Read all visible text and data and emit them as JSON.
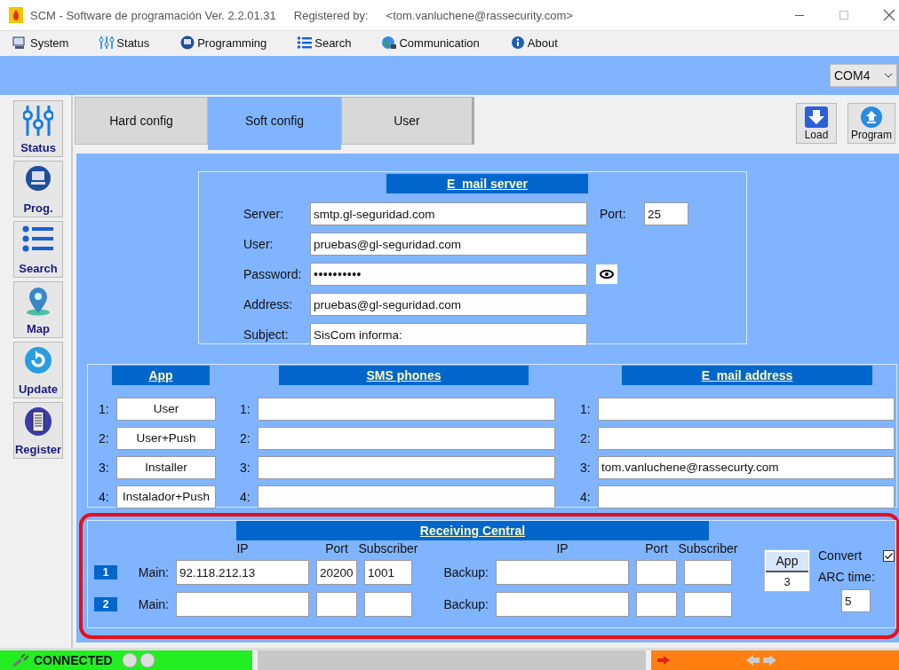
{
  "window": {
    "title": "SCM - Software de programación Ver. 2.2.01.31",
    "registered_label": "Registered by:",
    "registered_email": "<tom.vanluchene@rassecurity.com>"
  },
  "menu": [
    {
      "label": "System",
      "kind": "system"
    },
    {
      "label": "Status",
      "kind": "status"
    },
    {
      "label": "Programming",
      "kind": "programming"
    },
    {
      "label": "Search",
      "kind": "search"
    },
    {
      "label": "Communication",
      "kind": "communication"
    },
    {
      "label": "About",
      "kind": "about"
    }
  ],
  "port_select": {
    "value": "COM4"
  },
  "sidebar": [
    {
      "label": "Status",
      "kind": "status"
    },
    {
      "label": "Prog.",
      "kind": "prog"
    },
    {
      "label": "Search",
      "kind": "search"
    },
    {
      "label": "Map",
      "kind": "map"
    },
    {
      "label": "Update",
      "kind": "update"
    },
    {
      "label": "Register",
      "kind": "register"
    }
  ],
  "tabs": [
    {
      "label": "Hard config",
      "selected": false
    },
    {
      "label": "Soft config",
      "selected": true
    },
    {
      "label": "User",
      "selected": false
    }
  ],
  "actions": [
    {
      "label": "Load",
      "kind": "load"
    },
    {
      "label": "Program",
      "kind": "program"
    }
  ],
  "email_server": {
    "title": "E_mail server",
    "port_label": "Port:",
    "port": "25",
    "fields": [
      {
        "label": "Server:",
        "value": "smtp.gl-seguridad.com",
        "kind": "text"
      },
      {
        "label": "User:",
        "value": "pruebas@gl-seguridad.com",
        "kind": "text"
      },
      {
        "label": "Password:",
        "value": "••••••••••",
        "kind": "password"
      },
      {
        "label": "Address:",
        "value": "pruebas@gl-seguridad.com",
        "kind": "text"
      },
      {
        "label": "Subject:",
        "value": "SisCom informa:",
        "kind": "text"
      }
    ]
  },
  "app": {
    "title": "App",
    "rows": [
      {
        "number": "1:",
        "value": "User"
      },
      {
        "number": "2:",
        "value": "User+Push"
      },
      {
        "number": "3:",
        "value": "Installer"
      },
      {
        "number": "4:",
        "value": "Instalador+Push"
      }
    ]
  },
  "sms_phones": {
    "title": "SMS phones",
    "rows": [
      {
        "number": "1:"
      },
      {
        "number": "2:"
      },
      {
        "number": "3:"
      },
      {
        "number": "4:"
      }
    ]
  },
  "email_addresses": {
    "title": "E_mail address",
    "rows": [
      {
        "number": "1:"
      },
      {
        "number": "2:"
      },
      {
        "number": "3:",
        "value": "tom.vanluchene@rassecurty.com"
      },
      {
        "number": "4:"
      }
    ]
  },
  "receiving_central": {
    "title": "Receiving Central",
    "main_headers": [
      "IP",
      "Port",
      "Subscriber"
    ],
    "backup_headers": [
      "IP",
      "Port",
      "Subscriber"
    ],
    "lines": [
      {
        "number": "1",
        "main_label": "Main:",
        "main_ip": "92.118.212.13",
        "main_port": "20200",
        "main_subscriber": "1001",
        "backup_label": "Backup:"
      },
      {
        "number": "2",
        "main_label": "Main:",
        "backup_label": "Backup:"
      }
    ],
    "app_label": "App",
    "app_value": "3",
    "convert_label": "Convert",
    "convert_checked": true,
    "arc_label": "ARC time:",
    "arc_value": "5"
  },
  "status_bar": {
    "connection": "CONNECTED",
    "connected": true
  }
}
